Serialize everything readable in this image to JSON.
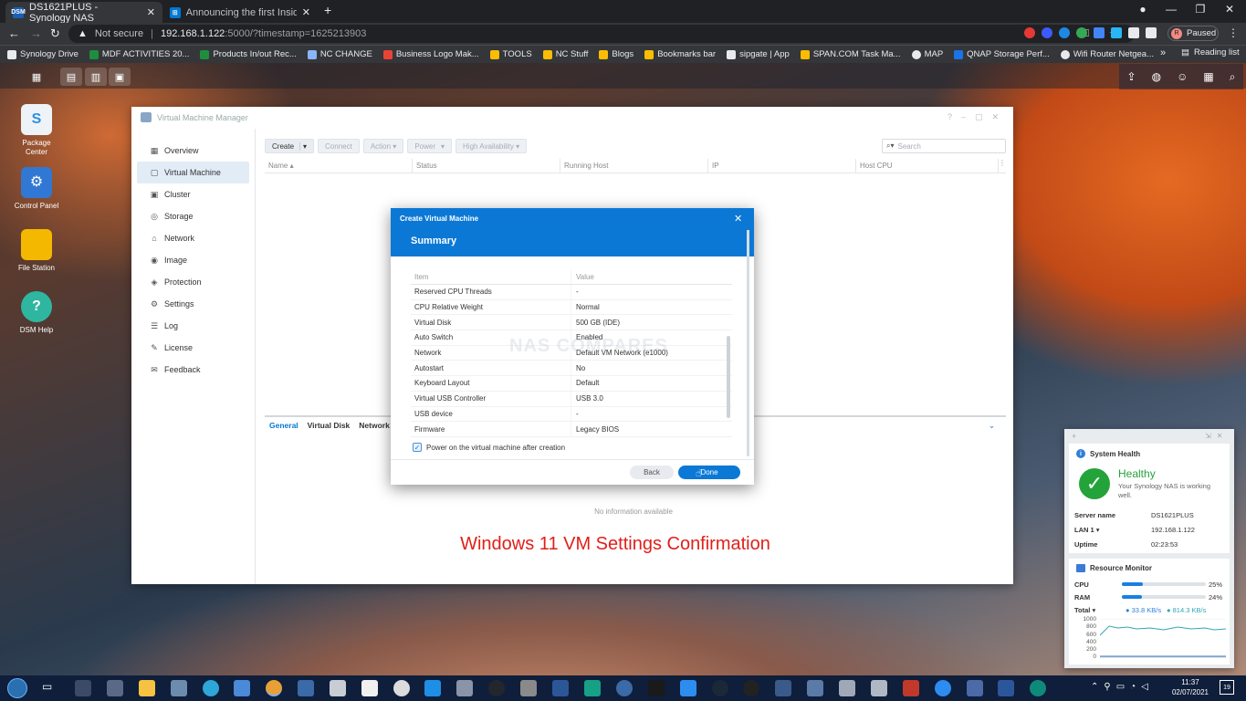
{
  "browser": {
    "tabs": [
      {
        "title": "DS1621PLUS - Synology NAS",
        "favicon": "DSM"
      },
      {
        "title": "Announcing the first Insider Pre..."
      }
    ],
    "new_tab": "+",
    "security": "Not secure",
    "url": "192.168.1.122",
    "url_rest": ":5000/?timestamp=1625213903",
    "profile_status": "Paused",
    "profile_initial": "R",
    "reading_list": "Reading list",
    "bookmarks": [
      {
        "label": "Synology Drive",
        "color": "#e8eaed"
      },
      {
        "label": "MDF ACTIVITIES 20...",
        "color": "#1e8e3e"
      },
      {
        "label": "Products In/out Rec...",
        "color": "#1e8e3e"
      },
      {
        "label": "NC CHANGE",
        "color": "#8ab4f8"
      },
      {
        "label": "Business Logo Mak...",
        "color": "#ea4335"
      },
      {
        "label": "TOOLS",
        "color": "#fbbc04"
      },
      {
        "label": "NC Stuff",
        "color": "#fbbc04"
      },
      {
        "label": "Blogs",
        "color": "#fbbc04"
      },
      {
        "label": "Bookmarks bar",
        "color": "#fbbc04"
      },
      {
        "label": "sipgate | App",
        "color": "#e8eaed"
      },
      {
        "label": "SPAN.COM Task Ma...",
        "color": "#fbbc04"
      },
      {
        "label": "MAP",
        "color": "#e8eaed"
      },
      {
        "label": "QNAP Storage Perf...",
        "color": "#1a73e8"
      },
      {
        "label": "Wifi Router Netgea...",
        "color": "#e8eaed"
      }
    ],
    "more": "»"
  },
  "desktop": {
    "icons": [
      {
        "label": "Package Center",
        "glyph": "S",
        "color": "#2e8fe0"
      },
      {
        "label": "Control Panel",
        "glyph": "⚙",
        "color": "#3178d4"
      },
      {
        "label": "File Station",
        "glyph": "",
        "color": "#f5b800"
      },
      {
        "label": "DSM Help",
        "glyph": "?",
        "color": "#2fb6a1"
      }
    ]
  },
  "vmm": {
    "title": "Virtual Machine Manager",
    "sidebar": [
      {
        "label": "Overview",
        "icon": "▦"
      },
      {
        "label": "Virtual Machine",
        "icon": "▢"
      },
      {
        "label": "Cluster",
        "icon": "▣"
      },
      {
        "label": "Storage",
        "icon": "◎"
      },
      {
        "label": "Network",
        "icon": "⌂"
      },
      {
        "label": "Image",
        "icon": "◉"
      },
      {
        "label": "Protection",
        "icon": "◈"
      },
      {
        "label": "Settings",
        "icon": "⚙"
      },
      {
        "label": "Log",
        "icon": "☰"
      },
      {
        "label": "License",
        "icon": "✎"
      },
      {
        "label": "Feedback",
        "icon": "✉"
      }
    ],
    "toolbar": [
      "Create",
      "Connect",
      "Action ▾",
      "Power",
      "High Availability ▾"
    ],
    "search_placeholder": "Search",
    "columns": [
      "Name ▴",
      "Status",
      "Running Host",
      "IP",
      "Host CPU"
    ],
    "bottom_tabs": [
      "General",
      "Virtual Disk",
      "Network"
    ],
    "no_info": "No information available"
  },
  "caption": "Windows 11 VM Settings Confirmation",
  "dialog": {
    "title": "Create Virtual Machine",
    "heading": "Summary",
    "col_item": "Item",
    "col_value": "Value",
    "rows": [
      {
        "item": "Reserved CPU Threads",
        "value": "-"
      },
      {
        "item": "CPU Relative Weight",
        "value": "Normal"
      },
      {
        "item": "Virtual Disk",
        "value": "500 GB (IDE)"
      },
      {
        "item": "Auto Switch",
        "value": "Enabled"
      },
      {
        "item": "Network",
        "value": "Default VM Network (e1000)"
      },
      {
        "item": "Autostart",
        "value": "No"
      },
      {
        "item": "Keyboard Layout",
        "value": "Default"
      },
      {
        "item": "Virtual USB Controller",
        "value": "USB 3.0"
      },
      {
        "item": "USB device",
        "value": "-"
      },
      {
        "item": "Firmware",
        "value": "Legacy BIOS"
      }
    ],
    "checkbox_label": "Power on the virtual machine after creation",
    "checkbox_checked": true,
    "back": "Back",
    "done": "Done",
    "watermark": "NAS COMPARES"
  },
  "health": {
    "title": "System Health",
    "status": "Healthy",
    "desc": "Your Synology NAS is working well.",
    "server_label": "Server name",
    "server": "DS1621PLUS",
    "lan_label": "LAN 1 ▾",
    "lan": "192.168.1.122",
    "uptime_label": "Uptime",
    "uptime": "02:23:53"
  },
  "resource": {
    "title": "Resource Monitor",
    "cpu_label": "CPU",
    "cpu_pct": 25,
    "cpu_text": "25%",
    "ram_label": "RAM",
    "ram_pct": 24,
    "ram_text": "24%",
    "total_label": "Total ▾",
    "up": "33.8 KB/s",
    "down": "814.3 KB/s",
    "yticks": [
      "1000",
      "800",
      "600",
      "400",
      "200",
      "0"
    ]
  },
  "taskbar": {
    "time": "11:37",
    "date": "02/07/2021",
    "notif": "19"
  }
}
